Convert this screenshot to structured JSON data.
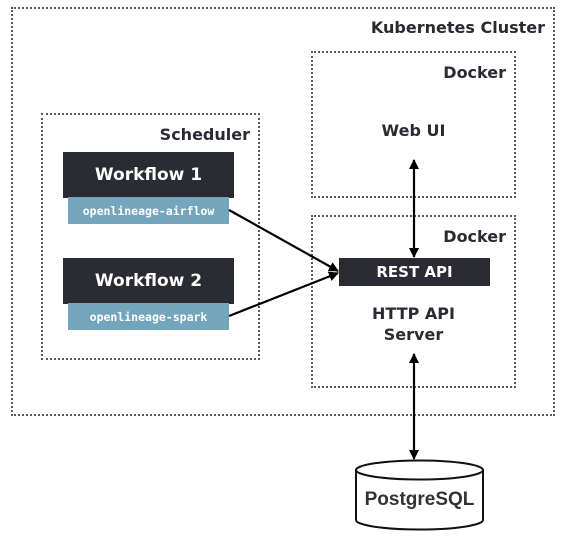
{
  "diagram": {
    "cluster": {
      "title": "Kubernetes Cluster"
    },
    "docker_web": {
      "title": "Docker",
      "label": "Web UI"
    },
    "docker_api": {
      "title": "Docker",
      "endpoint": "REST API",
      "label_line1": "HTTP API",
      "label_line2": "Server"
    },
    "scheduler": {
      "title": "Scheduler",
      "workflows": [
        {
          "name": "Workflow 1",
          "integration": "openlineage-airflow"
        },
        {
          "name": "Workflow 2",
          "integration": "openlineage-spark"
        }
      ]
    },
    "database": {
      "label": "PostgreSQL"
    },
    "edges": [
      {
        "from": "openlineage-airflow",
        "to": "REST API",
        "direction": "one-way"
      },
      {
        "from": "openlineage-spark",
        "to": "REST API",
        "direction": "one-way"
      },
      {
        "from": "Web UI",
        "to": "REST API",
        "direction": "two-way"
      },
      {
        "from": "HTTP API Server",
        "to": "PostgreSQL",
        "direction": "two-way"
      }
    ],
    "colors": {
      "dark_block": "#2b2b34",
      "integration_block": "#73a5bd",
      "border": "#555a60"
    }
  }
}
